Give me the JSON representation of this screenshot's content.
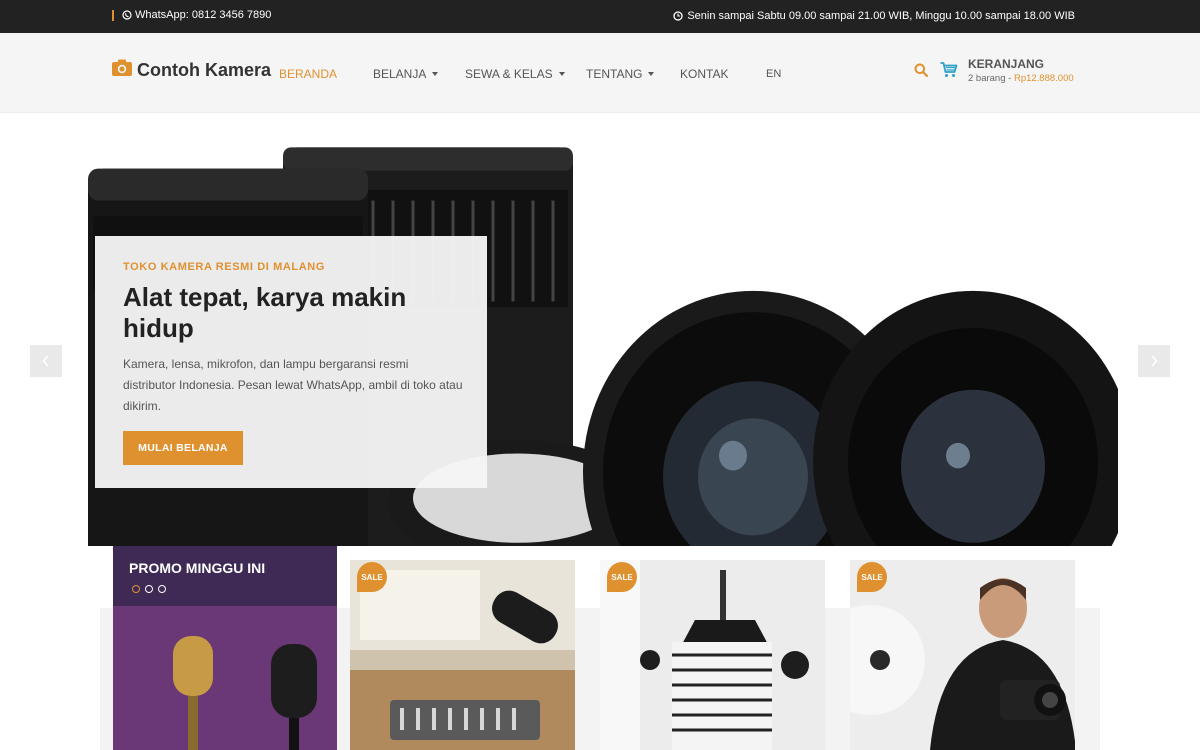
{
  "topbar": {
    "whatsapp": "WhatsApp: 0812 3456 7890",
    "hours": "Senin sampai Sabtu 09.00 sampai 21.00 WIB, Minggu 10.00 sampai 18.00 WIB"
  },
  "header": {
    "logo": "Contoh Kamera",
    "nav": [
      {
        "label": "BERANDA"
      },
      {
        "label": "BELANJA"
      },
      {
        "label": "SEWA & KELAS"
      },
      {
        "label": "TENTANG"
      },
      {
        "label": "KONTAK"
      },
      {
        "label": "EN"
      }
    ],
    "cart": {
      "title": "KERANJANG",
      "count": "2 barang -",
      "total": "Rp12.888.000"
    }
  },
  "hero": {
    "kicker": "TOKO KAMERA RESMI DI MALANG",
    "title": "Alat tepat, karya makin hidup",
    "text": "Kamera, lensa, mikrofon, dan lampu bergaransi resmi distributor Indonesia. Pesan lewat WhatsApp, ambil di toko atau dikirim.",
    "button": "MULAI BELANJA"
  },
  "promo": {
    "title": "PROMO MINGGU INI"
  },
  "products": [
    {
      "badge": "SALE"
    },
    {
      "badge": "SALE"
    },
    {
      "badge": "SALE"
    }
  ],
  "colors": {
    "accent": "#e0912f",
    "topbar": "#222222"
  }
}
